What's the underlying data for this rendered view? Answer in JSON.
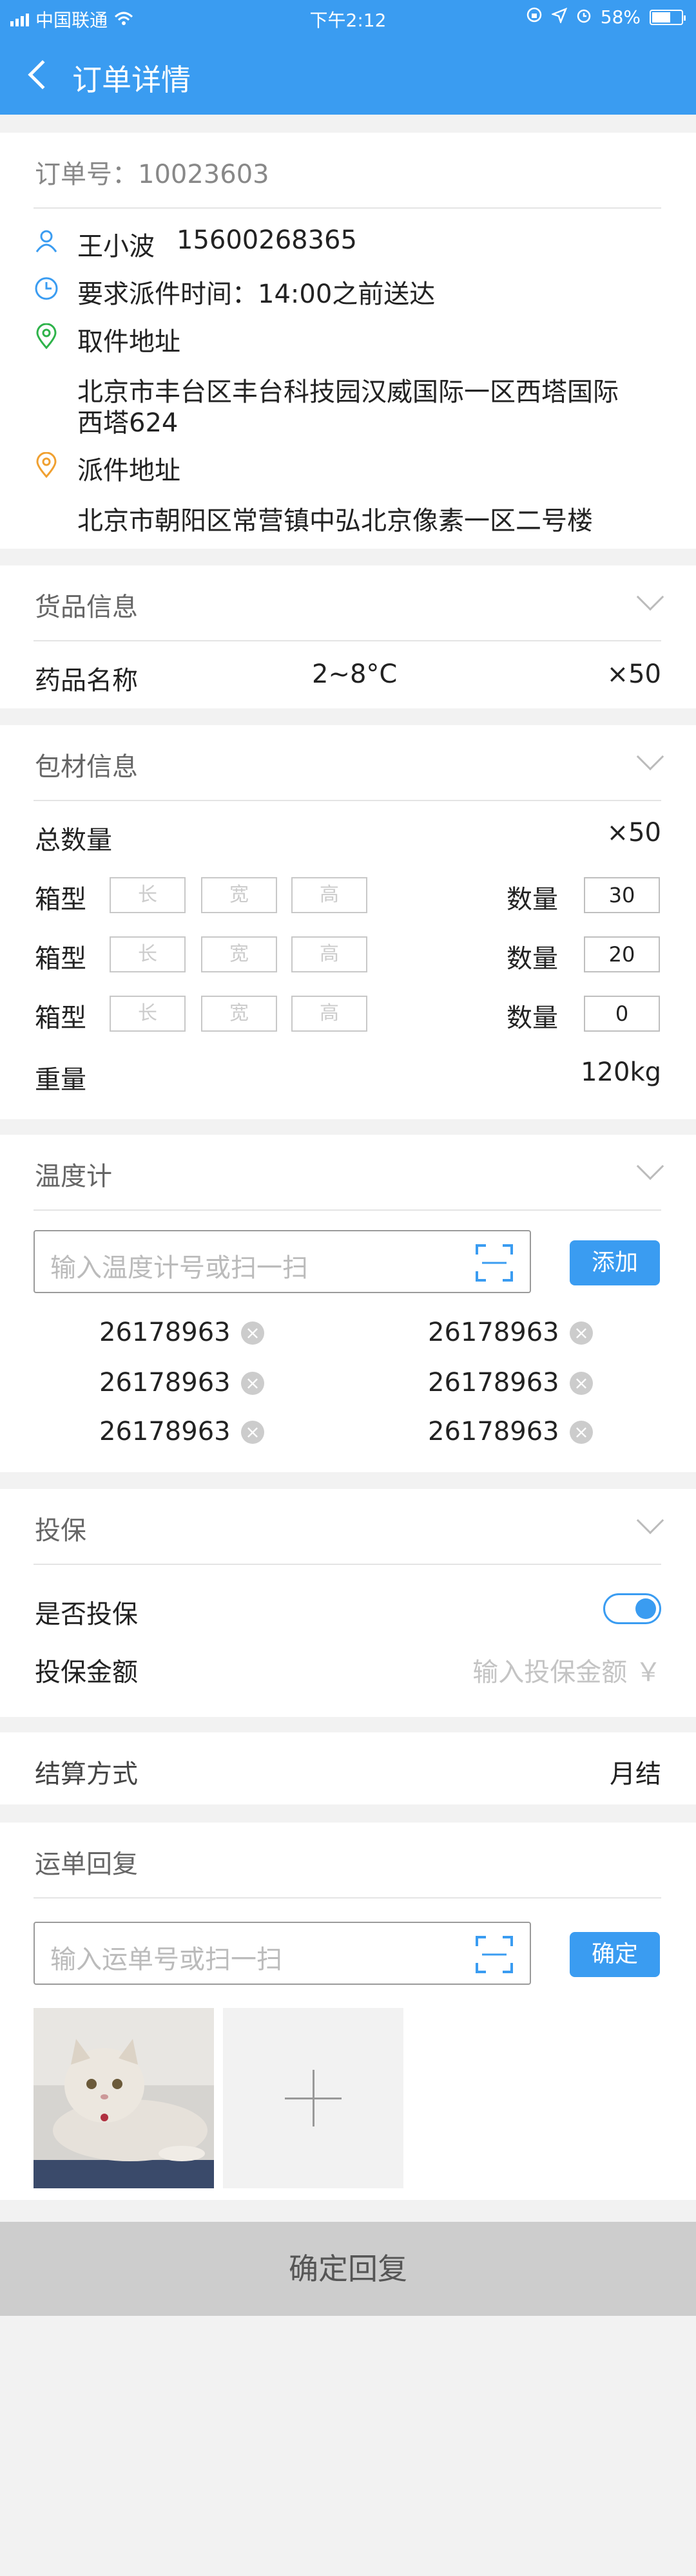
{
  "status_bar": {
    "carrier": "中国联通",
    "time": "下午2:12",
    "battery": "58%"
  },
  "nav": {
    "title": "订单详情"
  },
  "order": {
    "number_label": "订单号：10023603",
    "contact_name": "王小波",
    "contact_phone": "15600268365",
    "delivery_time": "要求派件时间：14:00之前送达",
    "pickup_label": "取件地址",
    "pickup_address_line1": "北京市丰台区丰台科技园汉威国际一区西塔国际",
    "pickup_address_line2": "西塔624",
    "delivery_label": "派件地址",
    "delivery_address": "北京市朝阳区常营镇中弘北京像素一区二号楼"
  },
  "goods": {
    "title": "货品信息",
    "name_label": "药品名称",
    "temp_range": "2~8°C",
    "quantity": "×50"
  },
  "packaging": {
    "title": "包材信息",
    "total_label": "总数量",
    "total_value": "×50",
    "box_label": "箱型",
    "qty_label": "数量",
    "dim_length": "长",
    "dim_width": "宽",
    "dim_height": "高",
    "rows": [
      {
        "qty": "30"
      },
      {
        "qty": "20"
      },
      {
        "qty": "0"
      }
    ],
    "weight_label": "重量",
    "weight_value": "120kg"
  },
  "thermometer": {
    "title": "温度计",
    "placeholder": "输入温度计号或扫一扫",
    "add_button": "添加",
    "items": [
      "26178963",
      "26178963",
      "26178963",
      "26178963",
      "26178963",
      "26178963"
    ]
  },
  "insurance": {
    "title": "投保",
    "insure_label": "是否投保",
    "insure_on": true,
    "amount_label": "投保金额",
    "amount_placeholder": "输入投保金额 ￥"
  },
  "settlement": {
    "label": "结算方式",
    "value": "月结"
  },
  "waybill": {
    "title": "运单回复",
    "placeholder": "输入运单号或扫一扫",
    "confirm_button": "确定"
  },
  "footer": {
    "confirm_reply": "确定回复"
  },
  "colors": {
    "accent": "#3a9cf1",
    "location_green": "#2eb34a",
    "location_orange": "#f0a030"
  },
  "icons": [
    "user-icon",
    "clock-icon",
    "location-pin-icon",
    "scan-icon",
    "close-circle-icon",
    "chevron-down-icon",
    "back-icon",
    "plus-icon"
  ]
}
